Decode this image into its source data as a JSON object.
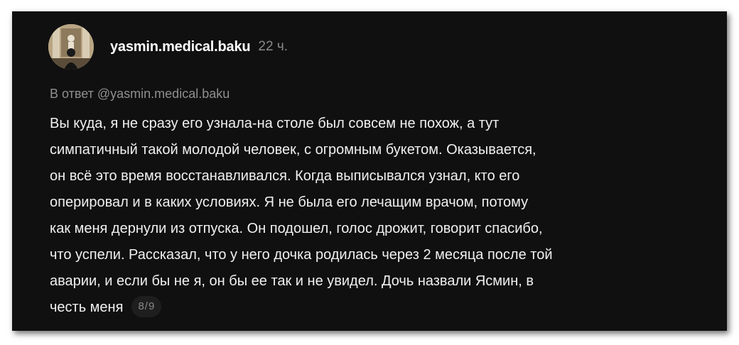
{
  "post": {
    "avatar_icon": "profile-avatar",
    "username": "yasmin.medical.baku",
    "time": "22 ч.",
    "reply_to": "В ответ @yasmin.medical.baku",
    "lines": [
      "Вы куда, я не сразу его узнала-на столе был совсем не похож, а тут",
      "симпатичный такой молодой человек, с огромным букетом. Оказывается,",
      "он всё это время восстанавливался. Когда выписывался узнал, кто его",
      "оперировал и в каких условиях. Я не была его лечащим врачом, потому",
      "как меня дернули из отпуска. Он подошел, голос дрожит, говорит спасибо,",
      "что успели. Рассказал, что у него дочка родилась через 2 месяца после той",
      "аварии, и если бы не я, он бы ее так и не увидел. Дочь назвали Ясмин, в",
      "честь меня"
    ],
    "pager": "8/9"
  },
  "colors": {
    "card_background": "#101010",
    "text": "#f0f0f0",
    "muted": "#8a8a8a"
  }
}
